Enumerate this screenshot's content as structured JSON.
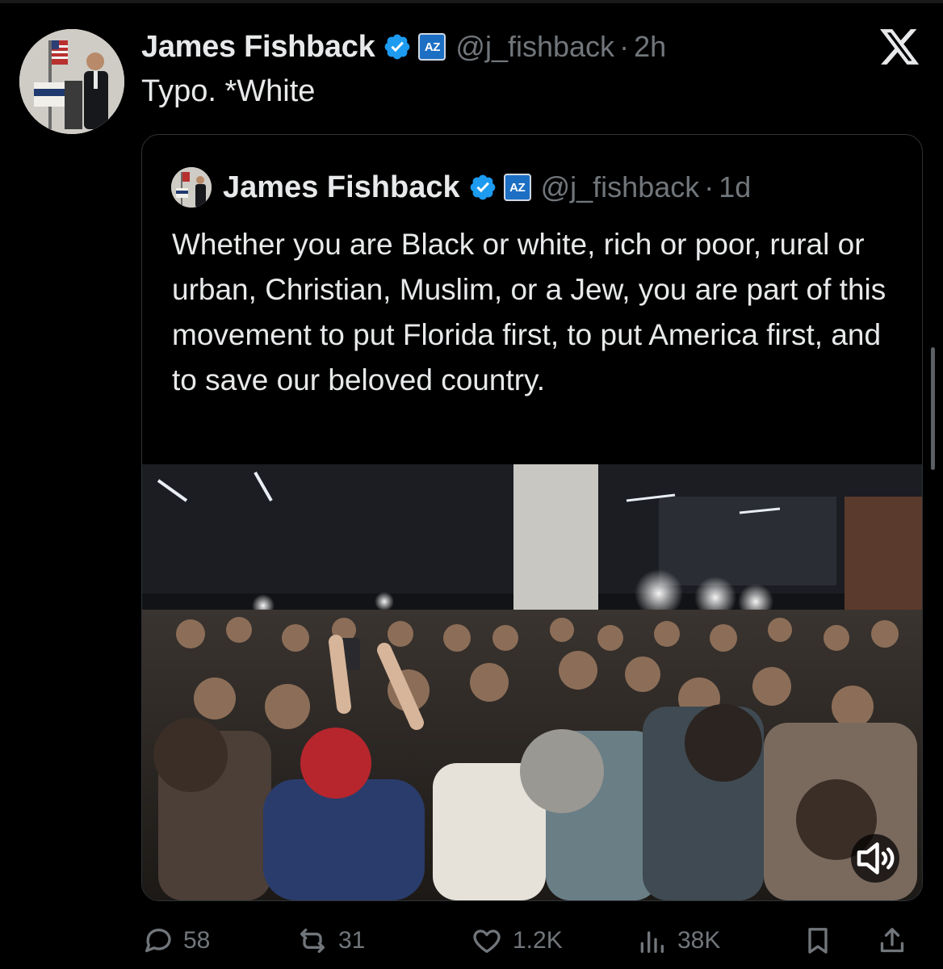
{
  "post": {
    "author_name": "James Fishback",
    "affiliate_badge": "AZ",
    "handle": "@j_fishback",
    "separator": "·",
    "time": "2h",
    "text": "Typo. *White"
  },
  "quoted_post": {
    "author_name": "James Fishback",
    "affiliate_badge": "AZ",
    "handle": "@j_fishback",
    "separator": "·",
    "time": "1d",
    "text": "Whether you are Black or white, rich or poor, rural or urban, Christian, Muslim, or a Jew, you are part of this movement to put Florida first, to put America first, and to save our beloved country.",
    "media": {
      "type": "video",
      "muted": true
    }
  },
  "actions": {
    "replies": "58",
    "reposts": "31",
    "likes": "1.2K",
    "views": "38K"
  },
  "icons": {
    "verified": "verified-badge-icon",
    "close": "x-logo-icon",
    "reply": "reply-icon",
    "repost": "repost-icon",
    "like": "heart-icon",
    "views": "views-icon",
    "bookmark": "bookmark-icon",
    "share": "share-icon",
    "sound": "volume-icon"
  },
  "colors": {
    "background": "#000000",
    "text": "#e7e9ea",
    "muted": "#71767b",
    "verified": "#1d9bf0",
    "badge": "#1d6fc4",
    "border": "#2f3336"
  }
}
